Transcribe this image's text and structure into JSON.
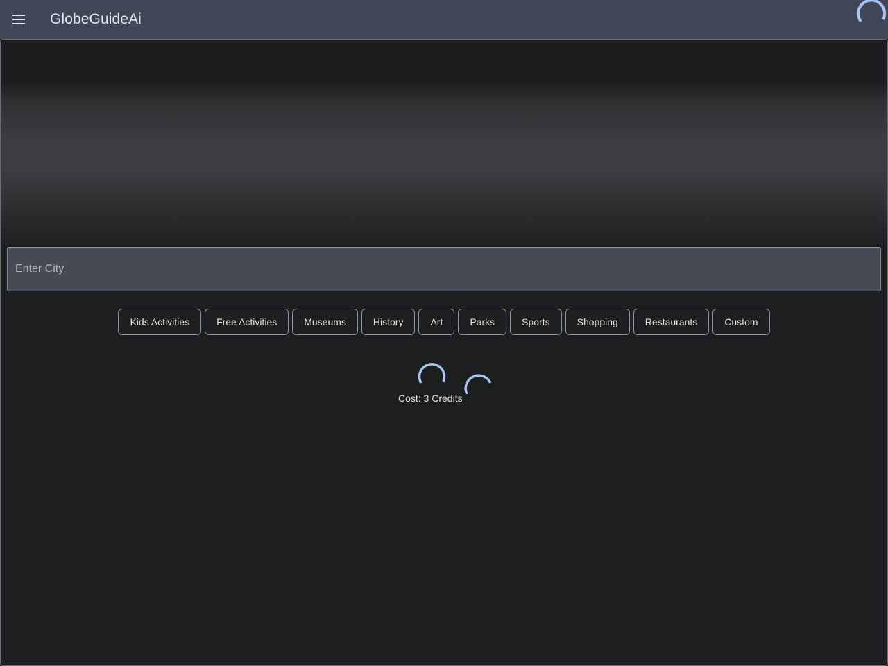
{
  "header": {
    "title": "GlobeGuideAi",
    "menu_icon": "menu-icon"
  },
  "search": {
    "placeholder": "Enter City",
    "value": ""
  },
  "categories": [
    {
      "label": "Kids Activities"
    },
    {
      "label": "Free Activities"
    },
    {
      "label": "Museums"
    },
    {
      "label": "History"
    },
    {
      "label": "Art"
    },
    {
      "label": "Parks"
    },
    {
      "label": "Sports"
    },
    {
      "label": "Shopping"
    },
    {
      "label": "Restaurants"
    },
    {
      "label": "Custom"
    }
  ],
  "status": {
    "cost_text": "Cost: 3 Credits"
  },
  "colors": {
    "header_bg": "#3e4658",
    "page_bg": "#1d1e20",
    "spinner": "#a8c4f0"
  }
}
